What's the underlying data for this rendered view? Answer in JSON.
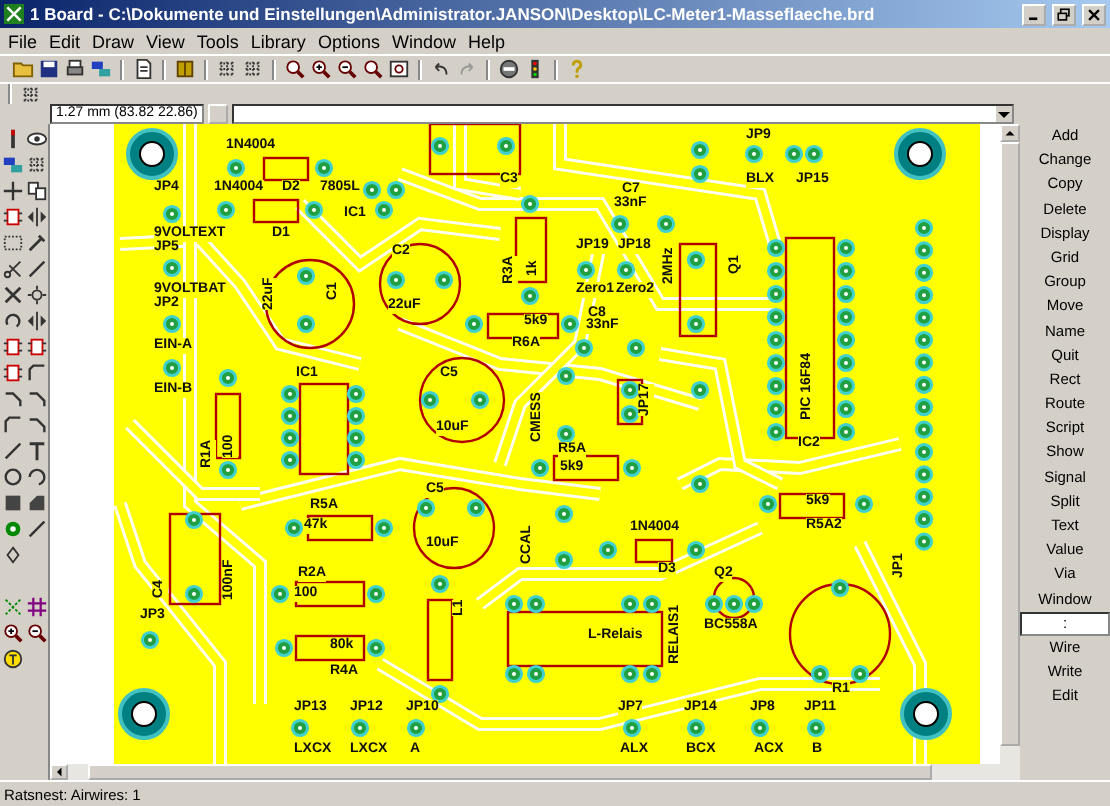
{
  "window": {
    "title": "1 Board - C:\\Dokumente und Einstellungen\\Administrator.JANSON\\Desktop\\LC-Meter1-Masseflaeche.brd"
  },
  "menu": [
    "File",
    "Edit",
    "Draw",
    "View",
    "Tools",
    "Library",
    "Options",
    "Window",
    "Help"
  ],
  "coordinates": "1.27 mm (83.82 22.86)",
  "commands": [
    {
      "label": "Add",
      "selected": false
    },
    {
      "label": "Change",
      "selected": false
    },
    {
      "label": "Copy",
      "selected": false
    },
    {
      "label": "Delete",
      "selected": false
    },
    {
      "label": "Display",
      "selected": false
    },
    {
      "label": "Grid",
      "selected": false
    },
    {
      "label": "Group",
      "selected": false
    },
    {
      "label": "Move",
      "selected": false
    },
    {
      "label": "Name",
      "selected": false
    },
    {
      "label": "Quit",
      "selected": false
    },
    {
      "label": "Rect",
      "selected": false
    },
    {
      "label": "Route",
      "selected": false
    },
    {
      "label": "Script",
      "selected": false
    },
    {
      "label": "Show",
      "selected": false
    },
    {
      "label": "Signal",
      "selected": false
    },
    {
      "label": "Split",
      "selected": false
    },
    {
      "label": "Text",
      "selected": false
    },
    {
      "label": "Value",
      "selected": false
    },
    {
      "label": "Via",
      "selected": false
    },
    {
      "label": "Window",
      "selected": false
    },
    {
      "label": ":",
      "selected": true
    },
    {
      "label": "Wire",
      "selected": false
    },
    {
      "label": "Write",
      "selected": false
    },
    {
      "label": "Edit",
      "selected": false
    }
  ],
  "board": {
    "labels": [
      "1N4004",
      "JP4",
      "1N4004",
      "D2",
      "7805L",
      "IC1",
      "9VOLTEXT",
      "JP5",
      "D1",
      "C3",
      "C7",
      "33nF",
      "JP9",
      "BLX",
      "JP15",
      "C2",
      "JP19",
      "JP18",
      "R3A",
      "1k",
      "2MHz",
      "Q1",
      "9VOLTBAT",
      "Zero1",
      "Zero2",
      "JP2",
      "C1",
      "22uF",
      "22uF",
      "5k9",
      "C8",
      "33nF",
      "R6A",
      "EIN-A",
      "EIN-B",
      "IC1",
      "C5",
      "JP17",
      "PIC 16F84",
      "CMESS",
      "10uF",
      "R1A",
      "100",
      "R5A",
      "IC2",
      "5k9",
      "R5A",
      "C5",
      "5k9",
      "47k",
      "1N4004",
      "R5A2",
      "10uF",
      "CCAL",
      "R2A",
      "D3",
      "JP1",
      "Q2",
      "100",
      "C4",
      "100nF",
      "L1",
      "JP3",
      "80k",
      "L-Relais",
      "BC558A",
      "RELAIS1",
      "R4A",
      "R1",
      "JP13",
      "JP12",
      "JP10",
      "JP7",
      "JP14",
      "JP8",
      "JP11",
      "LXCX",
      "LXCX",
      "A",
      "ALX",
      "BCX",
      "ACX",
      "B"
    ]
  },
  "status_bar": "Ratsnest: Airwires: 1"
}
